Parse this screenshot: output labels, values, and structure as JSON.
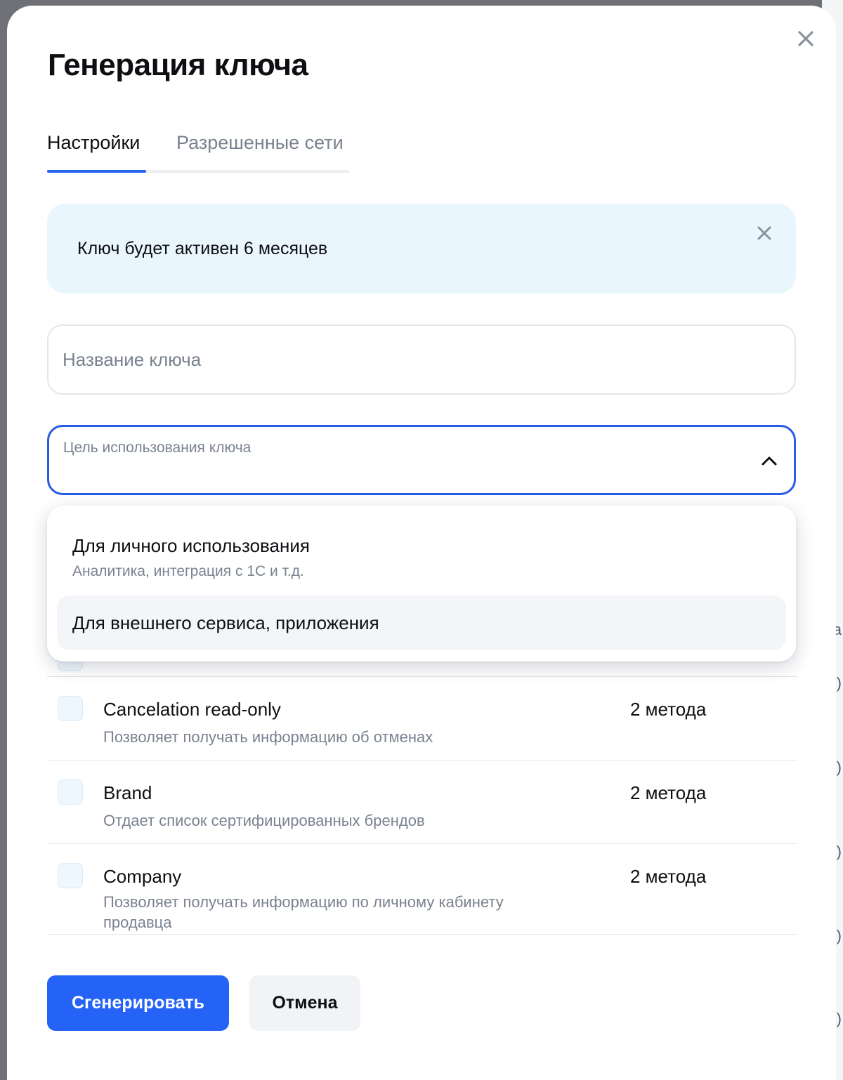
{
  "background_fragments": [
    ")",
    ")",
    ")",
    ")",
    ")"
  ],
  "background_letter": "a",
  "modal": {
    "title": "Генерация ключа",
    "close_icon": "close-icon"
  },
  "tabs": [
    {
      "label": "Настройки",
      "active": true
    },
    {
      "label": "Разрешенные сети",
      "active": false
    }
  ],
  "info_banner": {
    "text": "Ключ будет активен 6 месяцев",
    "close_icon": "close-icon"
  },
  "key_name_input": {
    "value": "",
    "placeholder": "Название ключа"
  },
  "purpose_select": {
    "label": "Цель использования ключа",
    "expanded": true,
    "icon": "chevron-up-icon",
    "options": [
      {
        "title": "Для личного использования",
        "subtitle": "Аналитика, интеграция с 1С и т.д."
      },
      {
        "title": "Для внешнего сервиса, приложения",
        "subtitle": "",
        "highlighted": true
      }
    ]
  },
  "methods": [
    {
      "name": "Cancelation read-only",
      "description": "Позволяет получать информацию об отменах",
      "count": "2 метода",
      "checked": false
    },
    {
      "name": "Brand",
      "description": "Отдает список сертифицированных брендов",
      "count": "2 метода",
      "checked": false
    },
    {
      "name": "Company",
      "description": "Позволяет получать информацию по личному кабинету продавца",
      "count": "2 метода",
      "checked": false
    }
  ],
  "actions": {
    "generate_label": "Сгенерировать",
    "cancel_label": "Отмена"
  },
  "colors": {
    "accent": "#2463f6",
    "focus_border": "#2a5be6",
    "info_bg": "#eaf6fd",
    "muted_text": "#7a8290"
  }
}
